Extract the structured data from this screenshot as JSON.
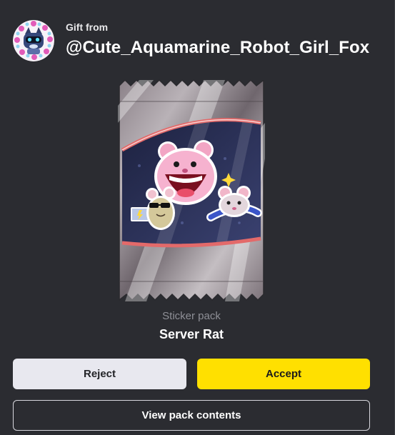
{
  "header": {
    "gift_from_label": "Gift from",
    "username": "@Cute_Aquamarine_Robot_Girl_Fox",
    "avatar_icon": "robot-fox-avatar-icon"
  },
  "pack": {
    "type_label": "Sticker pack",
    "name": "Server Rat",
    "image_icon": "sticker-pack-icon"
  },
  "actions": {
    "reject_label": "Reject",
    "accept_label": "Accept",
    "view_contents_label": "View pack contents"
  },
  "colors": {
    "background": "#2b2c31",
    "accept": "#ffe000",
    "reject": "#e8e8ef"
  }
}
